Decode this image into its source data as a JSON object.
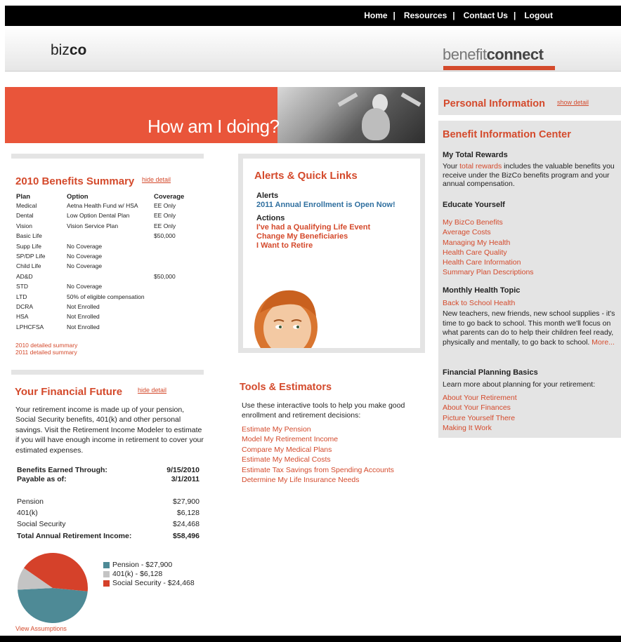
{
  "nav": {
    "home": "Home",
    "resources": "Resources",
    "contact": "Contact Us",
    "logout": "Logout",
    "sep": "|"
  },
  "header": {
    "company_prefix": "biz",
    "company_suffix": "co",
    "brand_light": "benefit",
    "brand_bold": "connect"
  },
  "hero": {
    "text": "How am I doing?"
  },
  "summary": {
    "title": "2010 Benefits Summary",
    "hide_link": "hide detail",
    "columns": [
      "Plan",
      "Option",
      "Coverage"
    ],
    "rows": [
      [
        "Medical",
        "Aetna Health Fund w/ HSA",
        "EE Only"
      ],
      [
        "Dental",
        "Low Option Dental Plan",
        "EE Only"
      ],
      [
        "Vision",
        "Vision Service Plan",
        "EE Only"
      ],
      [
        "Basic Life",
        "",
        "$50,000"
      ],
      [
        "Supp Life",
        "No Coverage",
        ""
      ],
      [
        "SP/DP Life",
        "No Coverage",
        ""
      ],
      [
        "Child Life",
        "No Coverage",
        ""
      ],
      [
        "AD&D",
        "",
        "$50,000"
      ],
      [
        "STD",
        "No Coverage",
        ""
      ],
      [
        "LTD",
        "50% of eligible compensation",
        ""
      ],
      [
        "DCRA",
        "Not Enrolled",
        ""
      ],
      [
        "HSA",
        "Not Enrolled",
        ""
      ],
      [
        "LPHCFSA",
        "Not Enrolled",
        ""
      ]
    ],
    "link_2010": "2010 detailed summary",
    "link_2011": "2011 detailed summary"
  },
  "financial": {
    "title": "Your Financial Future",
    "hide_link": "hide detail",
    "intro": "Your retirement income is made up of your pension, Social Security benefits, 401(k) and other personal savings. Visit the Retirement Income Modeler to estimate if you will have enough income in retirement to cover your estimated expenses.",
    "earned_label": "Benefits Earned Through:",
    "earned_value": "9/15/2010",
    "payable_label": "Payable as of:",
    "payable_value": "3/1/2011",
    "items": [
      {
        "label": "Pension",
        "value": "$27,900"
      },
      {
        "label": "401(k)",
        "value": "$6,128"
      },
      {
        "label": "Social Security",
        "value": "$24,468"
      }
    ],
    "total_label": "Total Annual Retirement Income:",
    "total_value": "$58,496",
    "view_assumptions": "View Assumptions"
  },
  "chart_data": {
    "type": "pie",
    "categories": [
      "Pension",
      "401(k)",
      "Social Security"
    ],
    "values": [
      27900,
      6128,
      24468
    ],
    "legend": [
      "Pension - $27,900",
      "401(k) - $6,128",
      "Social Security - $24,468"
    ],
    "colors": [
      "#4e8a96",
      "#c4c4c4",
      "#d5412a"
    ],
    "legend_position": "right"
  },
  "alerts": {
    "title": "Alerts & Quick Links",
    "alerts_heading": "Alerts",
    "alert_link": "2011 Annual Enrollment is Open Now!",
    "actions_heading": "Actions",
    "actions": [
      "I've had a Qualifying Life Event",
      "Change My Beneficiaries",
      "I Want to Retire"
    ]
  },
  "tools": {
    "title": "Tools & Estimators",
    "intro": "Use these interactive tools to help you make good enrollment and retirement decisions:",
    "links": [
      "Estimate My Pension",
      "Model My Retirement Income",
      "Compare My Medical Plans",
      "Estimate My Medical Costs",
      "Estimate Tax Savings from Spending Accounts",
      "Determine My Life Insurance Needs"
    ]
  },
  "personal": {
    "title": "Personal Information",
    "show_link": "show detail"
  },
  "bic": {
    "title": "Benefit Information Center",
    "rewards_heading": "My Total Rewards",
    "rewards_pre": "Your ",
    "rewards_link": "total rewards",
    "rewards_post": " includes the valuable benefits you receive under the BizCo benefits program and your annual compensation.",
    "educate_heading": "Educate Yourself",
    "educate_links": [
      "My BizCo Benefits",
      "Average Costs",
      "Managing My Health",
      "Health Care Quality",
      "Health Care Information",
      "Summary Plan Descriptions"
    ],
    "health_heading": "Monthly Health Topic",
    "health_link": "Back to School Health",
    "health_text": "New teachers, new friends, new school supplies - it's time to go back to school. This month we'll focus on what parents can do to help their children feel ready, physically and mentally, to go back to school.",
    "health_more": "More...",
    "planning_heading": "Financial Planning Basics",
    "planning_text": "Learn more about planning for your retirement:",
    "planning_links": [
      "About Your Retirement",
      "About Your Finances",
      "Picture Yourself There",
      "Making It Work"
    ]
  }
}
